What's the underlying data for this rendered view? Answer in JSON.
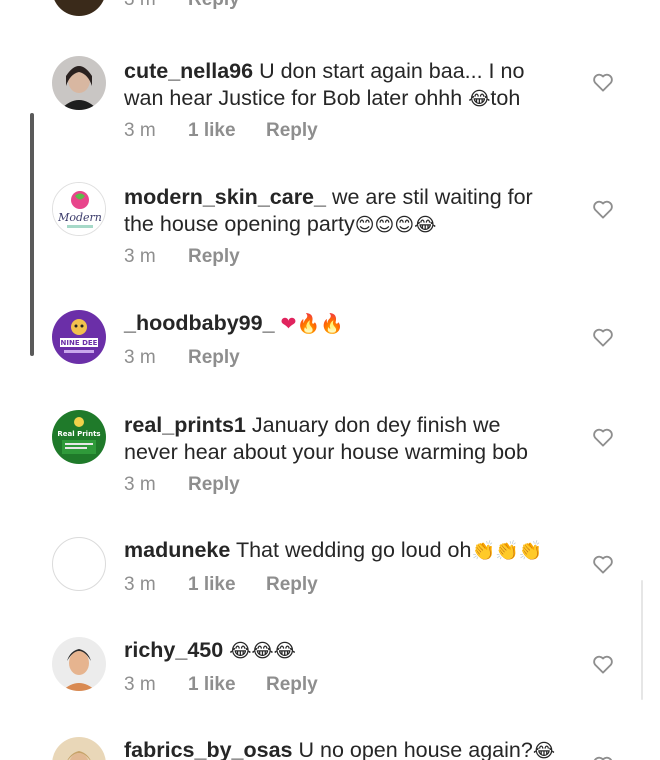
{
  "top_partial": {
    "time": "3 m",
    "reply": "Reply"
  },
  "comments": [
    {
      "username": "cute_nella96",
      "text_line1": "U don start again baa... I no",
      "text_line2": "wan hear Justice for Bob later ohhh ",
      "emoji_after": "😂",
      "text_tail": "toh",
      "time": "3 m",
      "likes": "1 like",
      "reply": "Reply"
    },
    {
      "username": "modern_skin_care_",
      "text_line1": "we are stil waiting for",
      "text_line2": "the house opening party",
      "emoji_after": "😊😊😊😂",
      "avatar_text": "Modern",
      "time": "3 m",
      "reply": "Reply"
    },
    {
      "username": "_hoodbaby99_",
      "emoji_after": "❤🔥🔥",
      "avatar_text": "NINE DEE",
      "time": "3 m",
      "reply": "Reply"
    },
    {
      "username": "real_prints1",
      "text_line1": "January don dey finish we",
      "text_line2": "never hear about your house warming bob",
      "avatar_text": "Real Prints",
      "time": "3 m",
      "reply": "Reply"
    },
    {
      "username": "maduneke",
      "text_line1": "That wedding go loud oh",
      "emoji_after": "👏👏👏",
      "time": "3 m",
      "likes": "1 like",
      "reply": "Reply"
    },
    {
      "username": "richy_450",
      "emoji_after": "😂😂😂",
      "time": "3 m",
      "likes": "1 like",
      "reply": "Reply"
    },
    {
      "username": "fabrics_by_osas",
      "text_line1": "U no open house again?",
      "emoji_after": "😂"
    }
  ],
  "colors": {
    "text": "#262626",
    "meta": "#8e8e8e",
    "heart": "#8e8e8e",
    "fire": "#f4900c",
    "heart_red": "#e0245e"
  },
  "icons": {
    "like": "heart-outline-icon"
  }
}
